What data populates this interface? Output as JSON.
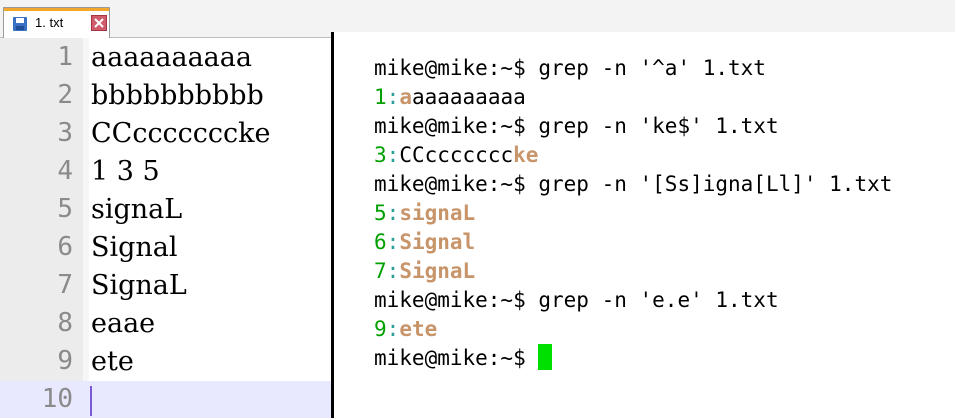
{
  "tab": {
    "label": "1. txt",
    "icons": {
      "save": "save-icon",
      "close": "close-icon"
    }
  },
  "editor": {
    "lines": [
      {
        "num": "1",
        "text": "aaaaaaaaaa"
      },
      {
        "num": "2",
        "text": "bbbbbbbbbb"
      },
      {
        "num": "3",
        "text": "CCcccccccke"
      },
      {
        "num": "4",
        "text": "1 3 5"
      },
      {
        "num": "5",
        "text": "signaL"
      },
      {
        "num": "6",
        "text": "Signal"
      },
      {
        "num": "7",
        "text": "SignaL"
      },
      {
        "num": "8",
        "text": "eaae"
      },
      {
        "num": "9",
        "text": "ete"
      },
      {
        "num": "10",
        "text": ""
      }
    ]
  },
  "terminal": {
    "prompt": "mike@mike:~$ ",
    "cmd1": "grep -n '^a' 1.txt",
    "r1_num": "1",
    "r1_sep": ":",
    "r1_hl": "a",
    "r1_rest": "aaaaaaaaa",
    "cmd2": "grep -n 'ke$' 1.txt",
    "r2_num": "3",
    "r2_sep": ":",
    "r2_pre": "CCccccccc",
    "r2_hl": "ke",
    "cmd3": "grep -n '[Ss]igna[Ll]' 1.txt",
    "r3_num": "5",
    "r3_sep": ":",
    "r3_hl": "signaL",
    "r4_num": "6",
    "r4_sep": ":",
    "r4_hl": "Signal",
    "r5_num": "7",
    "r5_sep": ":",
    "r5_hl": "SignaL",
    "cmd4": "grep -n 'e.e' 1.txt",
    "r6_num": "9",
    "r6_sep": ":",
    "r6_hl": "ete"
  },
  "colors": {
    "line_number": "#00a000",
    "separator": "#2aa198",
    "match": "#c8956b",
    "cursor": "#00e000",
    "tab_accent": "#f4a62a"
  }
}
